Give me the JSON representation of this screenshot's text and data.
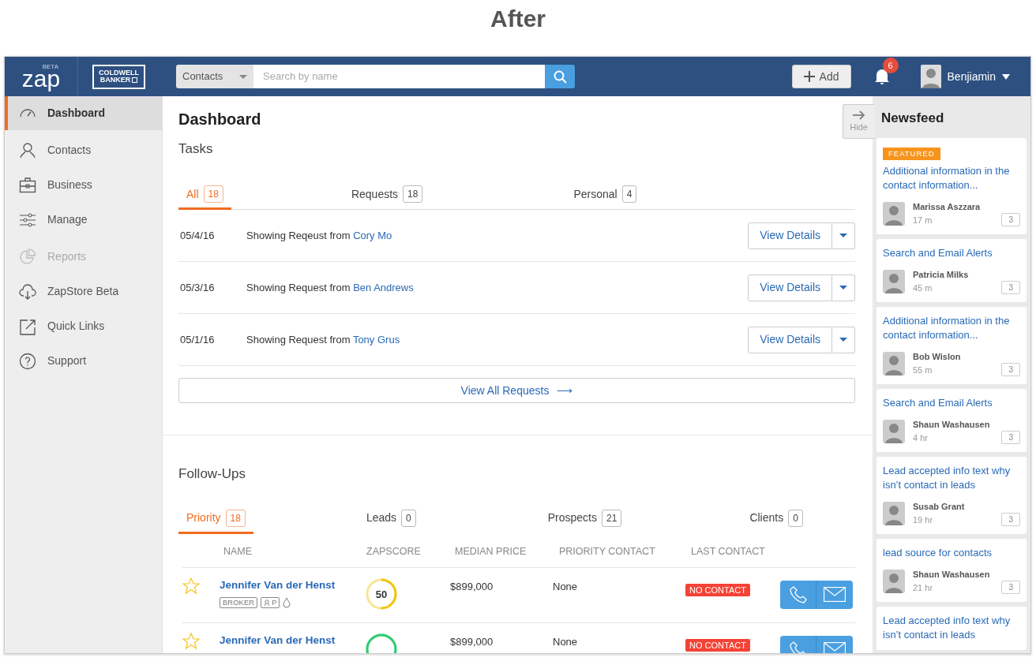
{
  "page_title": "After",
  "header": {
    "logo": {
      "text": "zap",
      "badge": "BETA"
    },
    "brand": {
      "line_1": "COLDWELL",
      "line_2": "BANKER"
    },
    "search": {
      "scope": "Contacts",
      "placeholder": "Search by name"
    },
    "add_button": "Add",
    "notifications": {
      "count": "6"
    },
    "user": {
      "name": "Benjiamin"
    }
  },
  "sidebar": {
    "items": [
      {
        "label": "Dashboard",
        "selected": true,
        "disabled": false
      },
      {
        "label": "Contacts",
        "selected": false,
        "disabled": false
      },
      {
        "label": "Business",
        "selected": false,
        "disabled": false
      },
      {
        "label": "Manage",
        "selected": false,
        "disabled": false
      },
      {
        "label": "Reports",
        "selected": false,
        "disabled": true
      },
      {
        "label": "ZapStore Beta",
        "selected": false,
        "disabled": false
      },
      {
        "label": "Quick Links",
        "selected": false,
        "disabled": false
      },
      {
        "label": "Support",
        "selected": false,
        "disabled": false
      }
    ]
  },
  "dashboard": {
    "title": "Dashboard",
    "tasks": {
      "title": "Tasks",
      "tabs": [
        {
          "label": "All",
          "count": "18",
          "selected": true
        },
        {
          "label": "Requests",
          "count": "18",
          "selected": false
        },
        {
          "label": "Personal",
          "count": "4",
          "selected": false
        }
      ],
      "rows": [
        {
          "date": "05/4/16",
          "text": "Showing Reqeust from",
          "contact": "Cory Mo",
          "button": "View Details"
        },
        {
          "date": "05/3/16",
          "text": "Showing Request from",
          "contact": "Ben Andrews",
          "button": "View Details"
        },
        {
          "date": "05/1/16",
          "text": "Showing Request from",
          "contact": "Tony Grus",
          "button": "View Details"
        }
      ],
      "view_all": "View All Requests",
      "view_all_arrow": "⟶"
    },
    "follow_ups": {
      "title": "Follow-Ups",
      "tabs": [
        {
          "label": "Priority",
          "count": "18",
          "selected": true
        },
        {
          "label": "Leads",
          "count": "0",
          "selected": false
        },
        {
          "label": "Prospects",
          "count": "21",
          "selected": false
        },
        {
          "label": "Clients",
          "count": "0",
          "selected": false
        }
      ],
      "columns": [
        "NAME",
        "ZAPSCORE",
        "MEDIAN PRICE",
        "PRIORITY CONTACT",
        "LAST CONTACT"
      ],
      "rows": [
        {
          "starred": false,
          "name": "Jennifer Van der Henst",
          "tags": [
            {
              "kind": "text",
              "label": "BROKER"
            },
            {
              "kind": "person",
              "label": "P"
            },
            {
              "kind": "drop"
            }
          ],
          "score": "50",
          "level": 0.5,
          "color": "#f1c40f",
          "price": "$899,000",
          "priority": "None",
          "last_contact": "NO CONTACT"
        },
        {
          "starred": false,
          "name": "Jennifer Van der Henst",
          "tags": [],
          "color": "#2ecc71",
          "price": "$899,000",
          "priority": "None",
          "last_contact": "NO CONTACT"
        }
      ]
    }
  },
  "newsfeed": {
    "title": "Newsfeed",
    "hide": "Hide",
    "items": [
      {
        "featured": true,
        "badge": "FEATURED",
        "title": "Additional information in the contact information...",
        "author": "Marissa Aszzara",
        "time": "17 m",
        "comments": "3"
      },
      {
        "featured": false,
        "title": "Search and Email Alerts",
        "author": "Patricia Milks",
        "time": "45 m",
        "comments": "3"
      },
      {
        "featured": false,
        "title": "Additional information in the contact information...",
        "author": "Bob Wislon",
        "time": "55 m",
        "comments": "3"
      },
      {
        "featured": false,
        "title": "Search and Email Alerts",
        "author": "Shaun Washausen",
        "time": "4 hr",
        "comments": "3"
      },
      {
        "featured": false,
        "title": "Lead accepted info text why isn’t contact in leads",
        "author": "Susab Grant",
        "time": "19 hr",
        "comments": "3"
      },
      {
        "featured": false,
        "title": "lead source for contacts",
        "author": "Shaun Washausen",
        "time": "21 hr",
        "comments": "3"
      },
      {
        "featured": false,
        "title": "Lead accepted info text why isn’t contact in leads"
      }
    ]
  }
}
